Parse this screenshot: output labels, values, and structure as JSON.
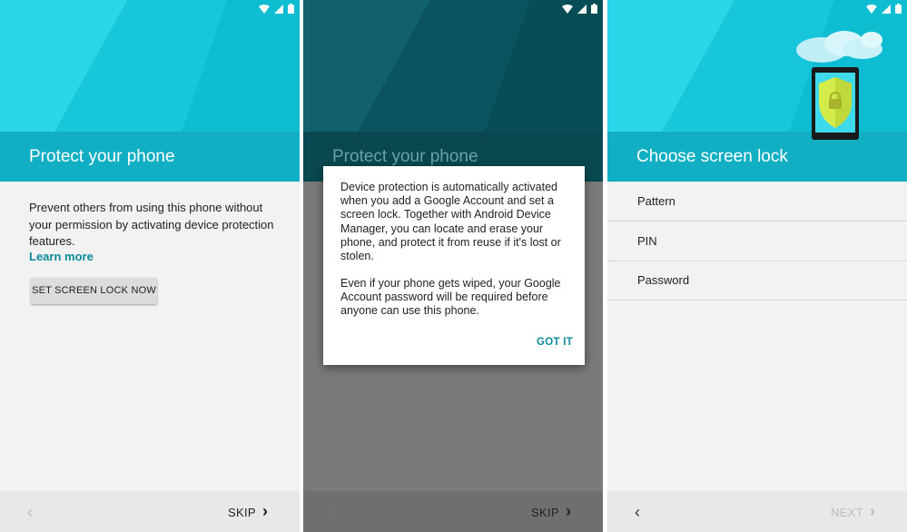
{
  "screens": [
    {
      "title": "Protect your phone",
      "body": "Prevent others from using this phone without your permission by activating device protection features.",
      "learn_more": "Learn more",
      "button": "SET SCREEN LOCK NOW",
      "back": "‹",
      "skip": "SKIP",
      "forward": "›"
    },
    {
      "title": "Protect your phone",
      "dialog": {
        "paragraph1": "Device protection is automatically activated when you add a Google Account and set a screen lock. Together with Android Device Manager, you can locate and erase your phone, and protect it from reuse if it's lost or stolen.",
        "paragraph2": "Even if your phone gets wiped, your Google Account password will be required before anyone can use this phone.",
        "got_it": "GOT IT"
      },
      "back": "‹",
      "skip": "SKIP",
      "forward": "›"
    },
    {
      "title": "Choose screen lock",
      "options": [
        "Pattern",
        "PIN",
        "Password"
      ],
      "back": "‹",
      "next": "NEXT",
      "forward": "›"
    }
  ],
  "icons": {
    "status": [
      "wifi-icon",
      "signal-icon",
      "battery-icon"
    ],
    "illustration": [
      "cloud-icon",
      "phone-shield-lock-icon"
    ]
  },
  "colors": {
    "hero": "#1fd0e6",
    "title_bar": "#12aec4",
    "accent_link": "#0c8b9c",
    "background": "#f2f2f2",
    "bottom_bar": "#e8e8e8"
  }
}
